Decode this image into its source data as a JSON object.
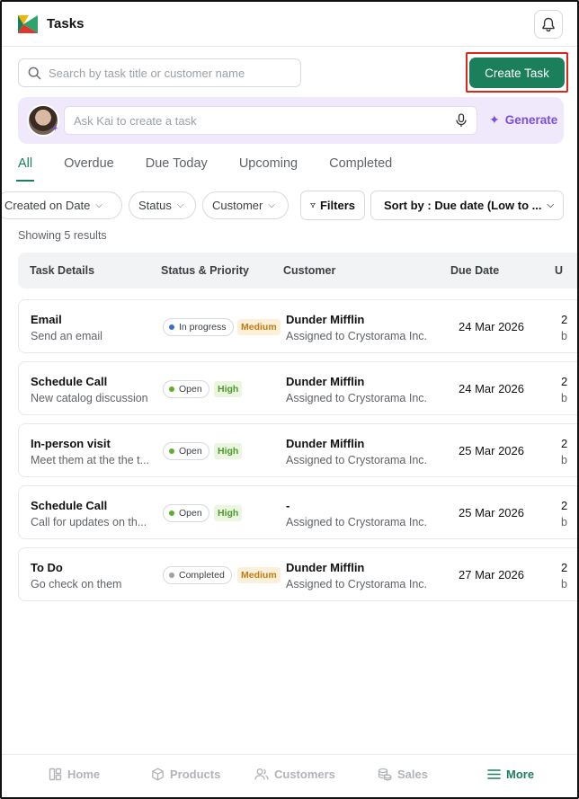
{
  "header": {
    "title": "Tasks",
    "logo_icon": "tasks-logo-icon",
    "notifications_icon": "bell-icon"
  },
  "search": {
    "placeholder": "Search by task title or customer name"
  },
  "create_task": {
    "label": "Create Task"
  },
  "kai": {
    "placeholder": "Ask Kai to create a task",
    "generate_label": "Generate"
  },
  "tabs": [
    "All",
    "Overdue",
    "Due Today",
    "Upcoming",
    "Completed"
  ],
  "active_tab": "All",
  "filters": {
    "created_on": "Created on Date",
    "status": "Status",
    "customer": "Customer",
    "filters_btn": "Filters",
    "sort_by": "Sort by : Due date (Low to ..."
  },
  "results_text": "Showing 5 results",
  "table": {
    "columns": [
      "Task Details",
      "Status & Priority",
      "Customer",
      "Due Date",
      "U"
    ],
    "rows": [
      {
        "title": "Email",
        "sub": "Send an email",
        "status": "In progress",
        "status_color": "#3b6fd4",
        "priority": "Medium",
        "customer": "Dunder Mifflin",
        "assigned": "Assigned to Crystorama Inc.",
        "due": "24 Mar 2026",
        "extra1": "2",
        "extra2": "b"
      },
      {
        "title": "Schedule Call",
        "sub": "New catalog discussion",
        "status": "Open",
        "status_color": "#5fae2e",
        "priority": "High",
        "customer": "Dunder Mifflin",
        "assigned": "Assigned to Crystorama Inc.",
        "due": "24 Mar 2026",
        "extra1": "2",
        "extra2": "b"
      },
      {
        "title": "In-person visit",
        "sub": "Meet them at the the t...",
        "status": "Open",
        "status_color": "#5fae2e",
        "priority": "High",
        "customer": "Dunder Mifflin",
        "assigned": "Assigned to Crystorama Inc.",
        "due": "25 Mar 2026",
        "extra1": "2",
        "extra2": "b"
      },
      {
        "title": "Schedule Call",
        "sub": "Call for updates on th...",
        "status": "Open",
        "status_color": "#5fae2e",
        "priority": "High",
        "customer": "-",
        "assigned": "Assigned to Crystorama Inc.",
        "due": "25 Mar 2026",
        "extra1": "2",
        "extra2": "b"
      },
      {
        "title": "To Do",
        "sub": "Go check on them",
        "status": "Completed",
        "status_color": "#9aa0a6",
        "priority": "Medium",
        "customer": "Dunder Mifflin",
        "assigned": "Assigned to Crystorama Inc.",
        "due": "27 Mar 2026",
        "extra1": "2",
        "extra2": "b"
      }
    ]
  },
  "bottom_nav": [
    {
      "label": "Home",
      "icon": "home-icon"
    },
    {
      "label": "Products",
      "icon": "box-icon"
    },
    {
      "label": "Customers",
      "icon": "users-icon"
    },
    {
      "label": "Sales",
      "icon": "coins-icon"
    },
    {
      "label": "More",
      "icon": "menu-icon",
      "active": true
    }
  ],
  "colors": {
    "brand": "#1a7f5a",
    "accent_purple": "#7c4ddb",
    "highlight_outline": "#e0261b"
  }
}
